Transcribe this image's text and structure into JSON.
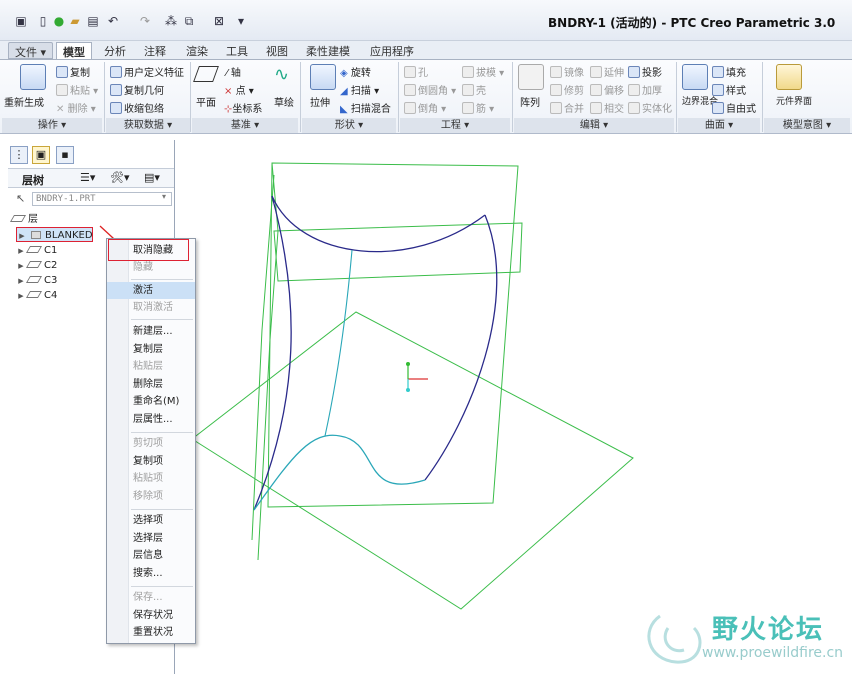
{
  "title_bar": {
    "title": "BNDRY-1 (活动的) - PTC Creo Parametric 3.0",
    "quick_access": [
      "app-icon",
      "new-icon",
      "open-session-icon",
      "open-icon",
      "save-icon",
      "undo-icon",
      "redo-icon",
      "regenerate-icon",
      "windows-icon",
      "close-window-icon",
      "customize-icon"
    ]
  },
  "tabs": [
    "文件",
    "模型",
    "分析",
    "注释",
    "渲染",
    "工具",
    "视图",
    "柔性建模",
    "应用程序"
  ],
  "active_tab": "模型",
  "ribbon": {
    "operations": {
      "label": "操作",
      "regenerate": "重新生成",
      "copy": "复制",
      "paste": "粘贴",
      "delete": "删除"
    },
    "get_data": {
      "label": "获取数据",
      "udf": "用户定义特征",
      "copy_geom": "复制几何",
      "shrinkwrap": "收缩包络"
    },
    "datum": {
      "label": "基准",
      "plane": "平面",
      "axis": "轴",
      "point": "点",
      "csys": "坐标系",
      "sketch": "草绘"
    },
    "shapes": {
      "label": "形状",
      "extrude": "拉伸",
      "revolve": "旋转",
      "sweep": "扫描",
      "swept_blend": "扫描混合"
    },
    "engineering": {
      "label": "工程",
      "hole": "孔",
      "round": "倒圆角",
      "chamfer": "倒角",
      "draft": "拔模",
      "shell": "壳",
      "rib": "筋"
    },
    "editing": {
      "label": "编辑",
      "pattern": "阵列",
      "mirror": "镜像",
      "trim": "修剪",
      "merge": "合并",
      "extend": "延伸",
      "offset": "偏移",
      "intersect": "相交",
      "project": "投影",
      "thicken": "加厚",
      "solidify": "实体化"
    },
    "surfaces": {
      "label": "曲面",
      "boundary_blend": "边界混合",
      "fill": "填充",
      "style": "样式",
      "freestyle": "自由式"
    },
    "model_intent": {
      "label": "模型意图",
      "component_interface": "元件界面"
    }
  },
  "left_panel": {
    "tree_title": "层树",
    "model_name": "BNDRY-1.PRT",
    "root": "层",
    "layers": [
      "BLANKED",
      "C1",
      "C2",
      "C3",
      "C4"
    ]
  },
  "context_menu": {
    "items": [
      {
        "label": "取消隐藏",
        "enabled": true
      },
      {
        "label": "隐藏",
        "enabled": false
      },
      {
        "label": "激活",
        "enabled": true
      },
      {
        "label": "取消激活",
        "enabled": false
      },
      {
        "label": "新建层...",
        "enabled": true
      },
      {
        "label": "复制层",
        "enabled": true
      },
      {
        "label": "粘贴层",
        "enabled": false
      },
      {
        "label": "删除层",
        "enabled": true
      },
      {
        "label": "重命名(M)",
        "enabled": true
      },
      {
        "label": "层属性...",
        "enabled": true
      },
      {
        "label": "剪切项",
        "enabled": false
      },
      {
        "label": "复制项",
        "enabled": true
      },
      {
        "label": "粘贴项",
        "enabled": false
      },
      {
        "label": "移除项",
        "enabled": false
      },
      {
        "label": "选择项",
        "enabled": true
      },
      {
        "label": "选择层",
        "enabled": true
      },
      {
        "label": "层信息",
        "enabled": true
      },
      {
        "label": "搜索...",
        "enabled": true
      },
      {
        "label": "保存...",
        "enabled": false
      },
      {
        "label": "保存状况",
        "enabled": true
      },
      {
        "label": "重置状况",
        "enabled": true
      }
    ]
  },
  "watermark": {
    "name": "野火论坛",
    "url": "www.proewildfire.cn"
  },
  "colors": {
    "datum_green": "#3bbd4a",
    "curve_blue": "#2a2a8a",
    "curve_cyan": "#2aa7b8",
    "highlight_red": "#d22"
  }
}
